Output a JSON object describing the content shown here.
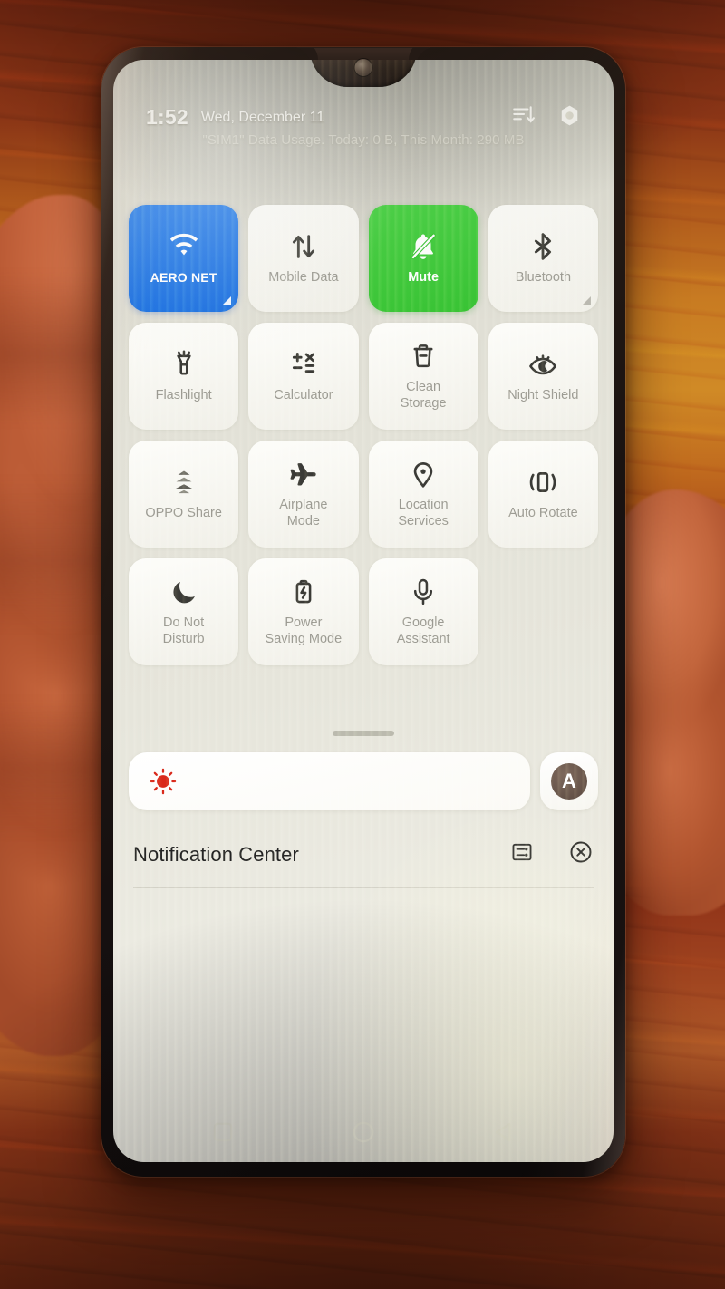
{
  "device": {
    "type": "smartphone",
    "orientation": "portrait",
    "screen_ui": "OPPO ColorOS Control Center / Quick Settings panel"
  },
  "status_bar": {
    "time": "1:52",
    "date": "Wed, December 11",
    "data_usage_text": "\"SIM1\" Data Usage. Today: 0 B, This Month: 290 MB",
    "icons": [
      {
        "name": "sort-order-icon",
        "glyph": "sort-descending"
      },
      {
        "name": "settings-gear-icon",
        "glyph": "gear"
      }
    ]
  },
  "quick_settings": {
    "rows": 4,
    "columns": 4,
    "tiles": [
      {
        "label": "AERO NET",
        "icon": "wifi-icon",
        "state": "on",
        "color": "#1b6fe0",
        "badge": true
      },
      {
        "label": "Mobile Data",
        "icon": "mobile-data-icon",
        "state": "off",
        "color": "#f4f3ec",
        "badge": false
      },
      {
        "label": "Mute",
        "icon": "bell-muted-icon",
        "state": "on",
        "color": "#38c334",
        "badge": false
      },
      {
        "label": "Bluetooth",
        "icon": "bluetooth-icon",
        "state": "off",
        "color": "#f4f3ec",
        "badge": true
      },
      {
        "label": "Flashlight",
        "icon": "flashlight-icon",
        "state": "off",
        "color": "#f4f3ec",
        "badge": false
      },
      {
        "label": "Calculator",
        "icon": "calculator-icon",
        "state": "off",
        "color": "#f4f3ec",
        "badge": false
      },
      {
        "label": "Clean\nStorage",
        "icon": "trash-clean-icon",
        "state": "off",
        "color": "#f4f3ec",
        "badge": false
      },
      {
        "label": "Night Shield",
        "icon": "night-shield-eye-icon",
        "state": "off",
        "color": "#f4f3ec",
        "badge": false
      },
      {
        "label": "OPPO Share",
        "icon": "oppo-share-icon",
        "state": "off",
        "color": "#f4f3ec",
        "badge": false
      },
      {
        "label": "Airplane\nMode",
        "icon": "airplane-icon",
        "state": "off",
        "color": "#f4f3ec",
        "badge": false
      },
      {
        "label": "Location\nServices",
        "icon": "location-pin-icon",
        "state": "off",
        "color": "#f4f3ec",
        "badge": false
      },
      {
        "label": "Auto Rotate",
        "icon": "auto-rotate-icon",
        "state": "off",
        "color": "#f4f3ec",
        "badge": false
      },
      {
        "label": "Do Not\nDisturb",
        "icon": "moon-icon",
        "state": "off",
        "color": "#f4f3ec",
        "badge": false
      },
      {
        "label": "Power\nSaving Mode",
        "icon": "battery-bolt-icon",
        "state": "off",
        "color": "#f4f3ec",
        "badge": false
      },
      {
        "label": "Google\nAssistant",
        "icon": "microphone-icon",
        "state": "off",
        "color": "#f4f3ec",
        "badge": false
      }
    ]
  },
  "brightness": {
    "slider_icon": "brightness-sun-icon",
    "slider_icon_color": "#d92a1c",
    "level_percent": 4,
    "auto_button_label": "A",
    "auto_button_name": "auto-brightness-toggle"
  },
  "notification_center": {
    "title": "Notification Center",
    "actions": [
      {
        "name": "notification-settings-icon",
        "glyph": "manage-notifications"
      },
      {
        "name": "clear-all-notifications-icon",
        "glyph": "x-circle"
      }
    ],
    "notifications": []
  },
  "navigation_bar": {
    "buttons": [
      {
        "name": "recents-button",
        "glyph": "square"
      },
      {
        "name": "home-button",
        "glyph": "circle"
      },
      {
        "name": "back-button",
        "glyph": "triangle-left"
      }
    ]
  },
  "environment": {
    "held_by": "hand",
    "background": "wooden furniture surface",
    "background_colors": [
      "#b05a1c",
      "#8a3516",
      "#c87b22"
    ]
  },
  "theme": {
    "accent_blue": "#1b6fe0",
    "accent_green": "#38c334",
    "tile_bg": "#f4f3ec",
    "screen_bg": "#e6e5db",
    "label_gray": "#9b9a92",
    "title_dark": "#232323"
  }
}
